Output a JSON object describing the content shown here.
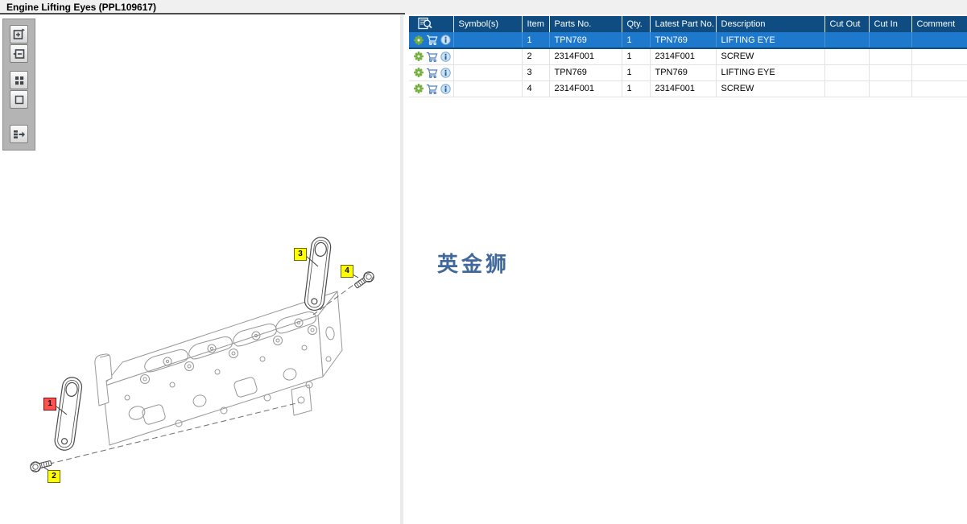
{
  "window": {
    "title": "Engine Lifting Eyes (PPL109617)"
  },
  "toolbar": {
    "buttons": [
      {
        "icon": "zoom-in-icon"
      },
      {
        "icon": "zoom-out-icon"
      },
      {
        "icon": "grid-view-icon"
      },
      {
        "icon": "fit-view-icon"
      },
      {
        "icon": "toggle-panel-icon"
      }
    ]
  },
  "parts_table": {
    "columns": [
      "",
      "Symbol(s)",
      "Item",
      "Parts No.",
      "Qty.",
      "Latest Part No.",
      "Description",
      "Cut Out",
      "Cut In",
      "Comment"
    ],
    "row_icons": [
      "gear-icon",
      "cart-icon",
      "info-icon"
    ],
    "rows": [
      {
        "item": "1",
        "parts_no": "TPN769",
        "qty": "1",
        "latest_part_no": "TPN769",
        "description": "LIFTING EYE",
        "cut_out": "",
        "cut_in": "",
        "comment": "",
        "selected": true
      },
      {
        "item": "2",
        "parts_no": "2314F001",
        "qty": "1",
        "latest_part_no": "2314F001",
        "description": "SCREW",
        "cut_out": "",
        "cut_in": "",
        "comment": "",
        "selected": false
      },
      {
        "item": "3",
        "parts_no": "TPN769",
        "qty": "1",
        "latest_part_no": "TPN769",
        "description": "LIFTING EYE",
        "cut_out": "",
        "cut_in": "",
        "comment": "",
        "selected": false
      },
      {
        "item": "4",
        "parts_no": "2314F001",
        "qty": "1",
        "latest_part_no": "2314F001",
        "description": "SCREW",
        "cut_out": "",
        "cut_in": "",
        "comment": "",
        "selected": false
      }
    ]
  },
  "diagram": {
    "watermark": "英金狮",
    "callouts": [
      {
        "label": "1",
        "color": "red"
      },
      {
        "label": "2",
        "color": "yellow"
      },
      {
        "label": "3",
        "color": "yellow"
      },
      {
        "label": "4",
        "color": "yellow"
      }
    ]
  },
  "colors": {
    "header_blue": "#0f4c81",
    "selected_row_blue": "#1e78cc",
    "callout_yellow": "#ffff00",
    "callout_red": "#ff5050",
    "watermark_blue": "#41689c",
    "gear_green": "#76b041",
    "cart_blue": "#4f81bd",
    "titlebar_gray": "#f0f0f0"
  }
}
